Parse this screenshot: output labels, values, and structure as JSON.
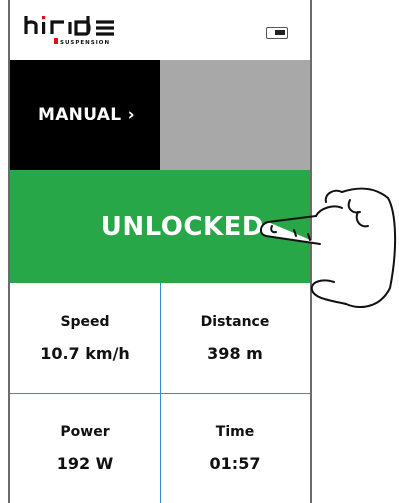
{
  "header": {
    "logo_text": "hi ride",
    "logo_subtext": "SUSPENSION",
    "battery_icon": "battery-icon"
  },
  "mode": {
    "manual_label": "MANUAL ›"
  },
  "lock": {
    "status_label": "UNLOCKED›",
    "color": "#27a747"
  },
  "stats": [
    {
      "label": "Speed",
      "value": "10.7 km/h"
    },
    {
      "label": "Distance",
      "value": "398 m"
    },
    {
      "label": "Power",
      "value": "192 W"
    },
    {
      "label": "Time",
      "value": "01:57"
    }
  ],
  "colors": {
    "accent_green": "#27a747",
    "divider_blue": "#2f8fd6",
    "panel_grey": "#a8a8a8",
    "manual_bg": "#000000"
  },
  "hand_icon": "pointing-hand-icon"
}
